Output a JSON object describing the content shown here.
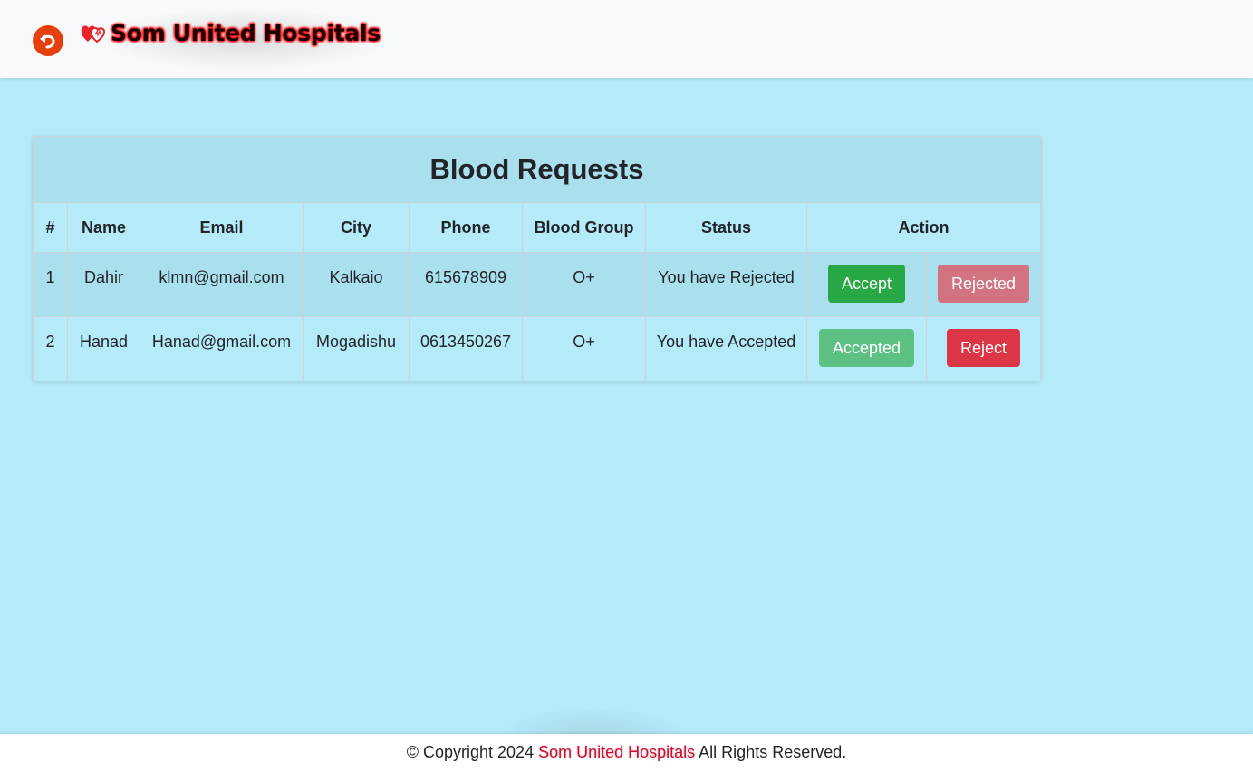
{
  "header": {
    "brand": "Som United Hospitals",
    "back_icon": "undo-arrow-icon",
    "logo_icon": "hearts-logo-icon",
    "colors": {
      "back_button": "#e5400d",
      "brand_glow": "#ff1a1a"
    }
  },
  "table": {
    "title": "Blood Requests",
    "columns": [
      "#",
      "Name",
      "Email",
      "City",
      "Phone",
      "Blood Group",
      "Status",
      "Action"
    ],
    "rows": [
      {
        "num": "1",
        "name": "Dahir",
        "email": "klmn@gmail.com",
        "city": "Kalkaio",
        "phone": "615678909",
        "blood_group": "O+",
        "status": "You have Rejected",
        "accept_label": "Accept",
        "reject_label": "Rejected"
      },
      {
        "num": "2",
        "name": "Hanad",
        "email": "Hanad@gmail.com",
        "city": "Mogadishu",
        "phone": "0613450267",
        "blood_group": "O+",
        "status": "You have Accepted",
        "accept_label": "Accepted",
        "reject_label": "Reject"
      }
    ]
  },
  "footer": {
    "prefix": "© Copyright 2024 ",
    "brand": "Som United Hospitals",
    "suffix": " All Rights Reserved."
  },
  "colors": {
    "page_bg": "#b5eaf9",
    "success": "#28a745",
    "danger": "#dc3545"
  }
}
